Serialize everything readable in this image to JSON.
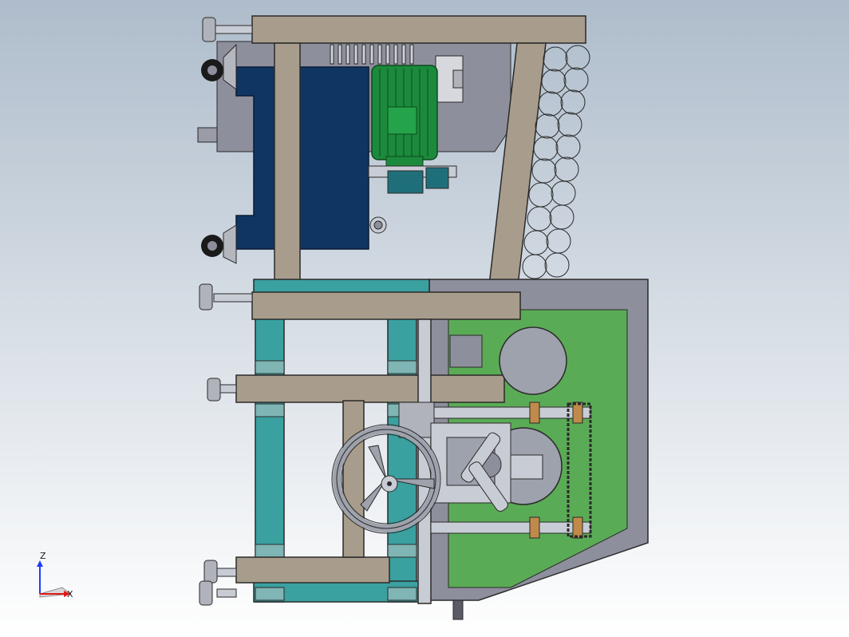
{
  "viewport": {
    "background_top": "#aebccb",
    "background_bottom": "#ffffff"
  },
  "triad": {
    "z_label": "Z",
    "x_label": "X",
    "z_color": "#1f3cff",
    "x_color": "#e01818"
  },
  "model": {
    "colors": {
      "frame_tan": "#a89d8c",
      "frame_teal": "#3aa1a0",
      "motor_green": "#1c8a3c",
      "tank_blue": "#0f3563",
      "panel_green": "#5aab55",
      "housing_gray": "#8e8f9c",
      "steel_light": "#c8ccd4",
      "outline": "#2a2a2a"
    },
    "icons": [
      "caster-wheel-icon",
      "leveling-foot-icon",
      "handwheel-icon",
      "electric-motor-icon",
      "sprocket-chain-icon"
    ]
  }
}
